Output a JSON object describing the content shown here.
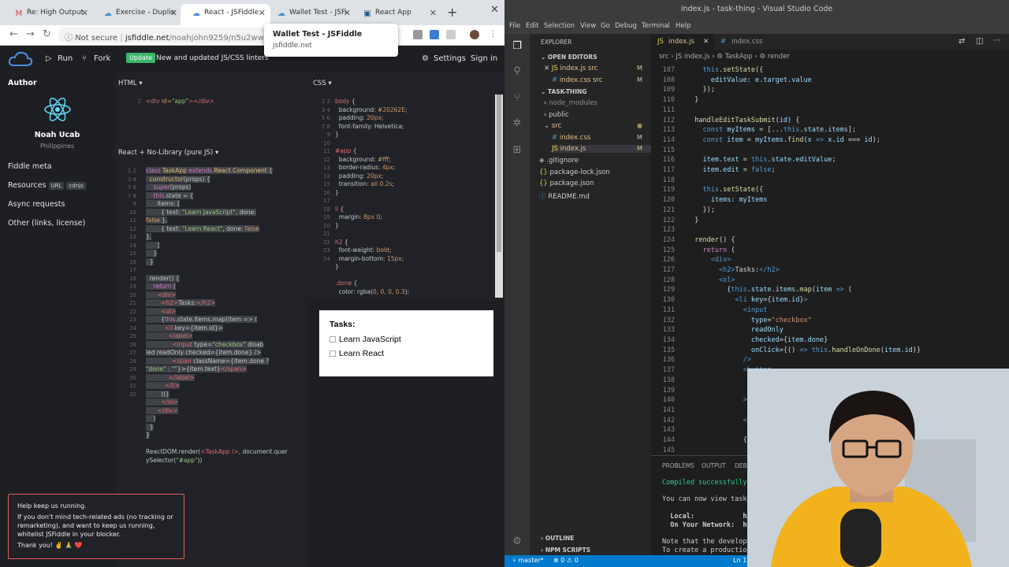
{
  "browser": {
    "tabs": [
      {
        "label": "Re: High Output",
        "fav": "M"
      },
      {
        "label": "Exercise - Duplic",
        "fav": "☁"
      },
      {
        "label": "React - JSFiddle",
        "fav": "☁"
      },
      {
        "label": "Wallet Test - JSFi",
        "fav": "☁"
      },
      {
        "label": "React App",
        "fav": "▣"
      }
    ],
    "url_prefix": "Not secure",
    "url_domain": "jsfiddle.net",
    "url_path": "/noahjohn9259/n5u2wwjg/1/28",
    "tooltip_title": "Wallet Test - JSFiddle",
    "tooltip_url": "jsfiddle.net"
  },
  "jsfiddle": {
    "run": "Run",
    "fork": "Fork",
    "update_badge": "Update",
    "update_text": "New and updated JS/CSS linters",
    "settings": "Settings",
    "signin": "Sign in",
    "sidebar": {
      "author_label": "Author",
      "name": "Noah Ucab",
      "location": "Philippines",
      "fiddle_meta": "Fiddle meta",
      "resources": "Resources",
      "url_pill": "URL",
      "cdnjs_pill": "cdnjs",
      "async": "Async requests",
      "other": "Other (links, license)"
    },
    "html_title": "HTML ▾",
    "css_title": "CSS ▾",
    "js_title": "React + No-Library (pure JS) ▾",
    "result": {
      "heading": "Tasks:",
      "items": [
        "Learn JavaScript",
        "Learn React"
      ]
    },
    "ad": {
      "l1": "Help keep us running.",
      "l2": "If you don't mind tech-related ads (no tracking or",
      "l3": "remarketing), and want to keep us running,",
      "l4": "whitelist JSFiddle in your blocker.",
      "l5": "Thank you! ✌️ 🙏 ❤️"
    }
  },
  "vscode": {
    "title": "index.js - task-thing - Visual Studio Code",
    "menu": [
      "File",
      "Edit",
      "Selection",
      "View",
      "Go",
      "Debug",
      "Terminal",
      "Help"
    ],
    "explorer": {
      "header": "EXPLORER",
      "open_editors": "OPEN EDITORS",
      "open_items": [
        "index.js  src",
        "index.css  src"
      ],
      "project": "TASK-THING",
      "tree": [
        "node_modules",
        "public",
        "src",
        "index.css",
        "index.js",
        ".gitignore",
        "package-lock.json",
        "package.json",
        "README.md"
      ],
      "outline": "OUTLINE",
      "npm": "NPM SCRIPTS"
    },
    "tabs": [
      "index.js",
      "index.css"
    ],
    "breadcrumb": "src  ›  JS index.js  ›  ⚙ TaskApp  ›  ⚙ render",
    "terminal": {
      "tabs": [
        "PROBLEMS",
        "OUTPUT",
        "DEBUG CONSOLE"
      ],
      "compiled": "Compiled successfully!",
      "view": "You can now view task-thing",
      "local": "  Local:            http://l",
      "network": "  On Your Network:  http://1",
      "note1": "Note that the development bu",
      "note2": "To create a production build"
    },
    "status_branch": "master*",
    "status_errors": "⊗ 0  ⚠ 0",
    "status_pos": "Ln 127"
  }
}
